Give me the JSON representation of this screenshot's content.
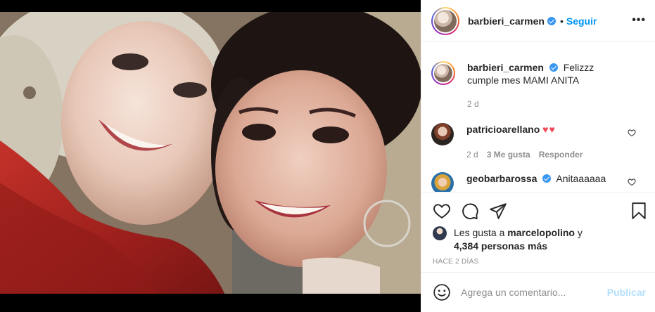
{
  "post": {
    "author": "barbieri_carmen",
    "follow_label": "Seguir",
    "more_label": "•••",
    "separator": "•"
  },
  "caption": {
    "user": "barbieri_carmen",
    "text": "Felizzz cumple mes MAMI ANITA",
    "time": "2 d"
  },
  "comments": [
    {
      "user": "patricioarellano",
      "text": "♥♥",
      "time": "2 d",
      "likes": "3 Me gusta",
      "reply": "Responder"
    },
    {
      "user": "geobarbarossa",
      "text": "Anitaaaaaa"
    }
  ],
  "likes": {
    "prefix": "Les gusta a",
    "user": "marcelopolino",
    "joiner": "y",
    "others": "4,384 personas más"
  },
  "timestamp": "HACE 2 DÍAS",
  "add_comment": {
    "placeholder": "Agrega un comentario...",
    "publish_label": "Publicar"
  },
  "icons": {
    "like": "heart-icon",
    "comment": "comment-icon",
    "share": "share-icon",
    "save": "bookmark-icon",
    "emoji": "emoji-icon",
    "more": "more-icon",
    "verified": "verified-icon"
  },
  "colors": {
    "accent": "#0095f6",
    "verified": "#3897f0",
    "heart_red": "#ed4956",
    "muted": "#8e8e8e",
    "publish_disabled": "#b2dffc",
    "border": "#efefef"
  }
}
